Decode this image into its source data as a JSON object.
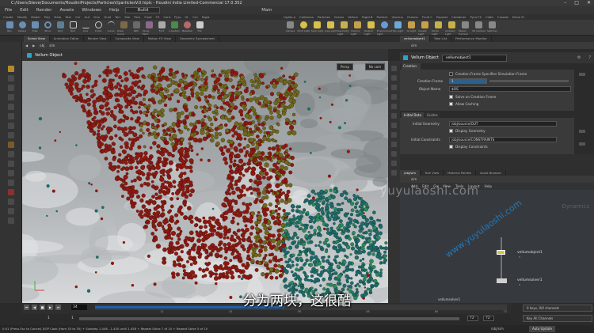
{
  "window": {
    "title": "C:/Users/Steve/Documents/HoudiniProjects/ParticlesV/particlesV.0.hiplc - Houdini Indie Limited-Commercial 17.0.352",
    "controls": [
      "–",
      "□",
      "✕"
    ]
  },
  "menu": {
    "items": [
      "File",
      "Edit",
      "Render",
      "Assets",
      "Windows",
      "Help"
    ],
    "desktop": "Build",
    "workspace": "Main"
  },
  "shelf": {
    "tabs": [
      "Create",
      "Modify",
      "Model",
      "Poly",
      "Defo",
      "Text",
      "Chr",
      "Aut",
      "Grm",
      "Guid",
      "Terr",
      "Sim",
      "Pers",
      "Fluid",
      "FX",
      "Cont",
      "Pyro",
      "VL",
      "Crn",
      "Rigid"
    ],
    "tabs2": [
      "Lights a",
      "Collisions",
      "Particles",
      "Grains",
      "Vellum",
      "Rigid B",
      "Particle",
      "Viscous",
      "Oceans",
      "Fluid C",
      "Populat",
      "Container",
      "Pyro FX",
      "Cloth",
      "Crowds",
      "Drive Si"
    ],
    "tools": [
      "Box",
      "Sphere",
      "Tube",
      "Torus",
      "Grid",
      "Null",
      "Line",
      "Circle",
      "Curve",
      "Draw Curve",
      "Path",
      "Spray Paint",
      "Font",
      "L-System",
      "Metaball",
      "File"
    ],
    "light_tools": [
      "Camera",
      "Point Light",
      "Spot Light",
      "Area Light",
      "Geometry Light",
      "Volume Light",
      "Distant Light",
      "Environment Light",
      "Sky Light",
      "GI Light",
      "Caustic Light",
      "Portal Light",
      "Ambient Light",
      "Stereo Camera",
      "VR Camera",
      "Switcher"
    ]
  },
  "left_pane": {
    "tabs": [
      "Scene View",
      "Animation Editor",
      "Render View",
      "Composite View",
      "Motion FX View",
      "Geometry Spreadsheet"
    ],
    "path": [
      "obj",
      "sim"
    ],
    "header": "Vellum Object",
    "viewport": {
      "persp_label": "Persp",
      "cam_label": "No cam"
    }
  },
  "param_pane": {
    "tabs": [
      "vellumobject1",
      "Take List",
      "Performance Monitor"
    ],
    "path": "sim",
    "node_type": "Vellum Object",
    "node_name": "vellumobject1",
    "section_tab": "Creation",
    "rows": {
      "creation_frame_specifies": "Creation Frame Specifies Simulation Frame",
      "creation_frame_label": "Creation Frame",
      "creation_frame_value": "1",
      "object_name_label": "Object Name",
      "object_name_value": "$OS",
      "solve_on_creation": "Solve on Creation Frame",
      "allow_caching": "Allow Caching"
    },
    "initial_tabs": [
      "Initial Data",
      "Guides"
    ],
    "initial_rows": {
      "initial_geometry_label": "Initial Geometry",
      "initial_geometry_value": "/obj/source/OUT",
      "display_geometry": "Display Geometry",
      "initial_constraints_label": "Initial Constraints",
      "initial_constraints_value": "/obj/source/CONSTRAINTS",
      "display_constraints": "Display Constraints"
    }
  },
  "network_pane": {
    "tabs": [
      "/obj/sim",
      "Tree View",
      "Material Palette",
      "Asset Browser"
    ],
    "path": "sim",
    "menu": [
      "Add",
      "Edit",
      "Go",
      "View",
      "Tools",
      "Layout",
      "Help"
    ],
    "context_label": "Dynamics",
    "nodes": [
      {
        "name": "vellumobject1",
        "sub": "n"
      },
      {
        "name": "vellumsolver1",
        "sub": "n"
      },
      {
        "name": "vellumsolver1",
        "sub": ""
      }
    ]
  },
  "timeline": {
    "buttons": [
      "⏮",
      "◀",
      "■",
      "▶",
      "⏭"
    ],
    "current_frame": "34",
    "start_frame": "1",
    "start_frame2": "1",
    "end_frame": "72",
    "end_frame2": "72",
    "progress": 0.46,
    "ticks": [
      "12",
      "24",
      "36",
      "48",
      "60",
      "72"
    ],
    "channels_label": "0 keys, 0/0 channels",
    "key_all_label": "Key All Channels"
  },
  "status": {
    "message": "0:01 (Press Esc to Cancel) DOP Cook (from 35 to 35) + Substep 1.446 - 1.450 until 1.458 + Repeat Solve 7 of 10 + Repeat Solve 5 of 10",
    "path_label": "/obj/sim",
    "update_label": "Auto Update"
  },
  "overlay": {
    "subtitle": "分为两块，这很酷",
    "watermark1": "yuyulaoshi.com",
    "watermark2": "www.yuyulaoshi.com"
  },
  "colors": {
    "particle_red": "#8a1a12",
    "particle_olive": "#6b6a1c",
    "particle_teal": "#1f6a6a",
    "node_selected": "#d9c34a",
    "accent_blue": "#29a3c8"
  }
}
